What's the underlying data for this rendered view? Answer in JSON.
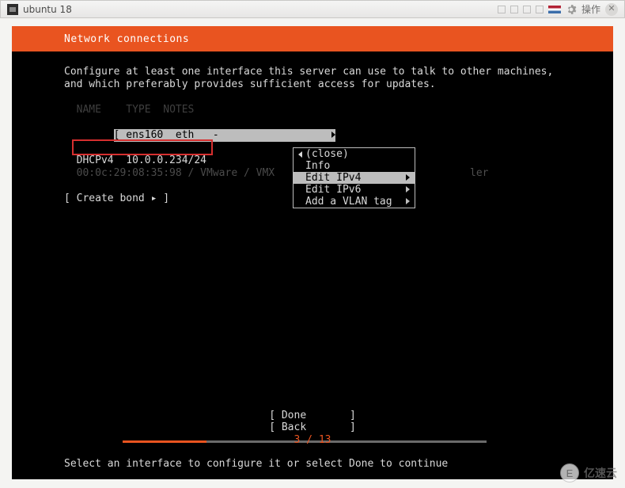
{
  "window": {
    "title": "ubuntu 18",
    "action_label": "操作"
  },
  "header": {
    "title": "Network connections"
  },
  "instructions": {
    "line1": "Configure at least one interface this server can use to talk to other machines,",
    "line2": "and which preferably provides sufficient access for updates."
  },
  "table": {
    "headers": {
      "name": "NAME",
      "type": "TYPE",
      "notes": "NOTES"
    },
    "rows": [
      {
        "display": "[ ens160  eth   -",
        "name": "ens160",
        "type": "eth",
        "notes": "-"
      },
      {
        "display": "  DHCPv4  10.0.0.234/24",
        "label": "DHCPv4",
        "value": "10.0.0.234/24"
      },
      {
        "display": "  00:0c:29:08:35:98 / VMware / VMX",
        "mac": "00:0c:29:08:35:98",
        "vendor": "VMware / VMX"
      }
    ],
    "behind_text": "ler"
  },
  "create_bond": "[ Create bond ▸ ]",
  "context_menu": {
    "items": [
      {
        "label": "(close)",
        "has_submenu": false,
        "has_back": true
      },
      {
        "label": "Info",
        "has_submenu": false
      },
      {
        "label": "Edit IPv4",
        "has_submenu": true,
        "selected": true
      },
      {
        "label": "Edit IPv6",
        "has_submenu": true
      },
      {
        "label": "Add a VLAN tag",
        "has_submenu": true
      }
    ]
  },
  "footer": {
    "buttons": [
      "[ Done       ]",
      "[ Back       ]"
    ],
    "help": "Select an interface to configure it or select Done to continue"
  },
  "progress": {
    "current": 3,
    "total": 13,
    "label": "3 / 13"
  },
  "watermark": {
    "text": "亿速云"
  }
}
